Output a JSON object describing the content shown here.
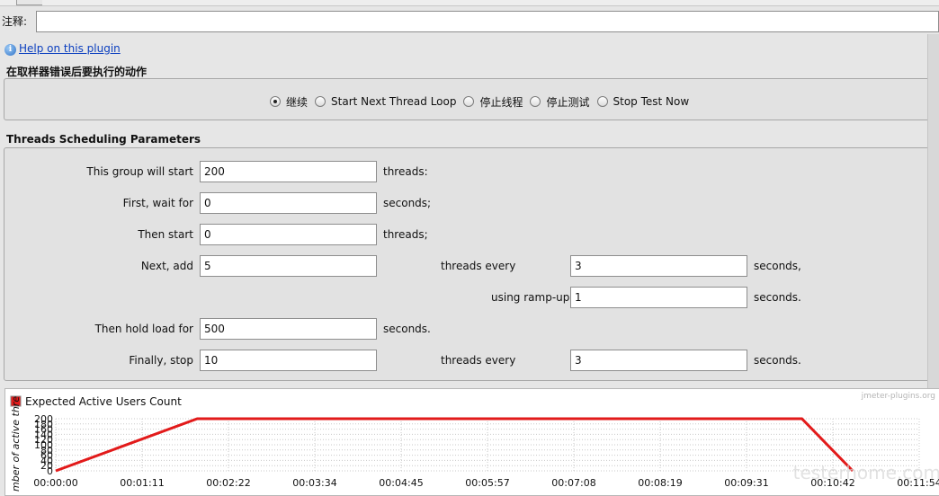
{
  "comment": {
    "label": "注释:",
    "value": ""
  },
  "help": {
    "link_text": "Help on this plugin"
  },
  "error_action": {
    "title": "在取样器错误后要执行的动作",
    "options": [
      "继续",
      "Start Next Thread Loop",
      "停止线程",
      "停止测试",
      "Stop Test Now"
    ],
    "selected": "继续"
  },
  "scheduling": {
    "title": "Threads Scheduling Parameters",
    "start_label": "This group will start",
    "start_value": "200",
    "start_unit": "threads:",
    "wait_label": "First, wait for",
    "wait_value": "0",
    "wait_unit": "seconds;",
    "then_start_label": "Then start",
    "then_start_value": "0",
    "then_start_unit": "threads;",
    "next_add_label": "Next, add",
    "next_add_value": "5",
    "threads_every_label": "threads every",
    "threads_every_value": "3",
    "threads_every_unit": "seconds,",
    "rampup_label": "using ramp-up",
    "rampup_value": "1",
    "rampup_unit": "seconds.",
    "hold_label": "Then hold load for",
    "hold_value": "500",
    "hold_unit": "seconds.",
    "stop_label": "Finally, stop",
    "stop_value": "10",
    "stop_every_label": "threads every",
    "stop_every_value": "3",
    "stop_every_unit": "seconds."
  },
  "chart_data": {
    "type": "line",
    "legend": "Expected Active Users Count",
    "ylabel": "mber of active thre",
    "watermark": "jmeter-plugins.org",
    "watermark2": "testerhome.com",
    "series_color": "#e21a1a",
    "x_ticks": [
      "00:00:00",
      "00:01:11",
      "00:02:22",
      "00:03:34",
      "00:04:45",
      "00:05:57",
      "00:07:08",
      "00:08:19",
      "00:09:31",
      "00:10:42",
      "00:11:54"
    ],
    "y_ticks": [
      "0",
      "20",
      "40",
      "60",
      "80",
      "100",
      "120",
      "140",
      "160",
      "180",
      "200"
    ],
    "ylim": [
      0,
      200
    ],
    "xlim_seconds": [
      0,
      714
    ],
    "points_seconds": [
      [
        0,
        0
      ],
      [
        117,
        200
      ],
      [
        617,
        200
      ],
      [
        659,
        0
      ]
    ]
  }
}
